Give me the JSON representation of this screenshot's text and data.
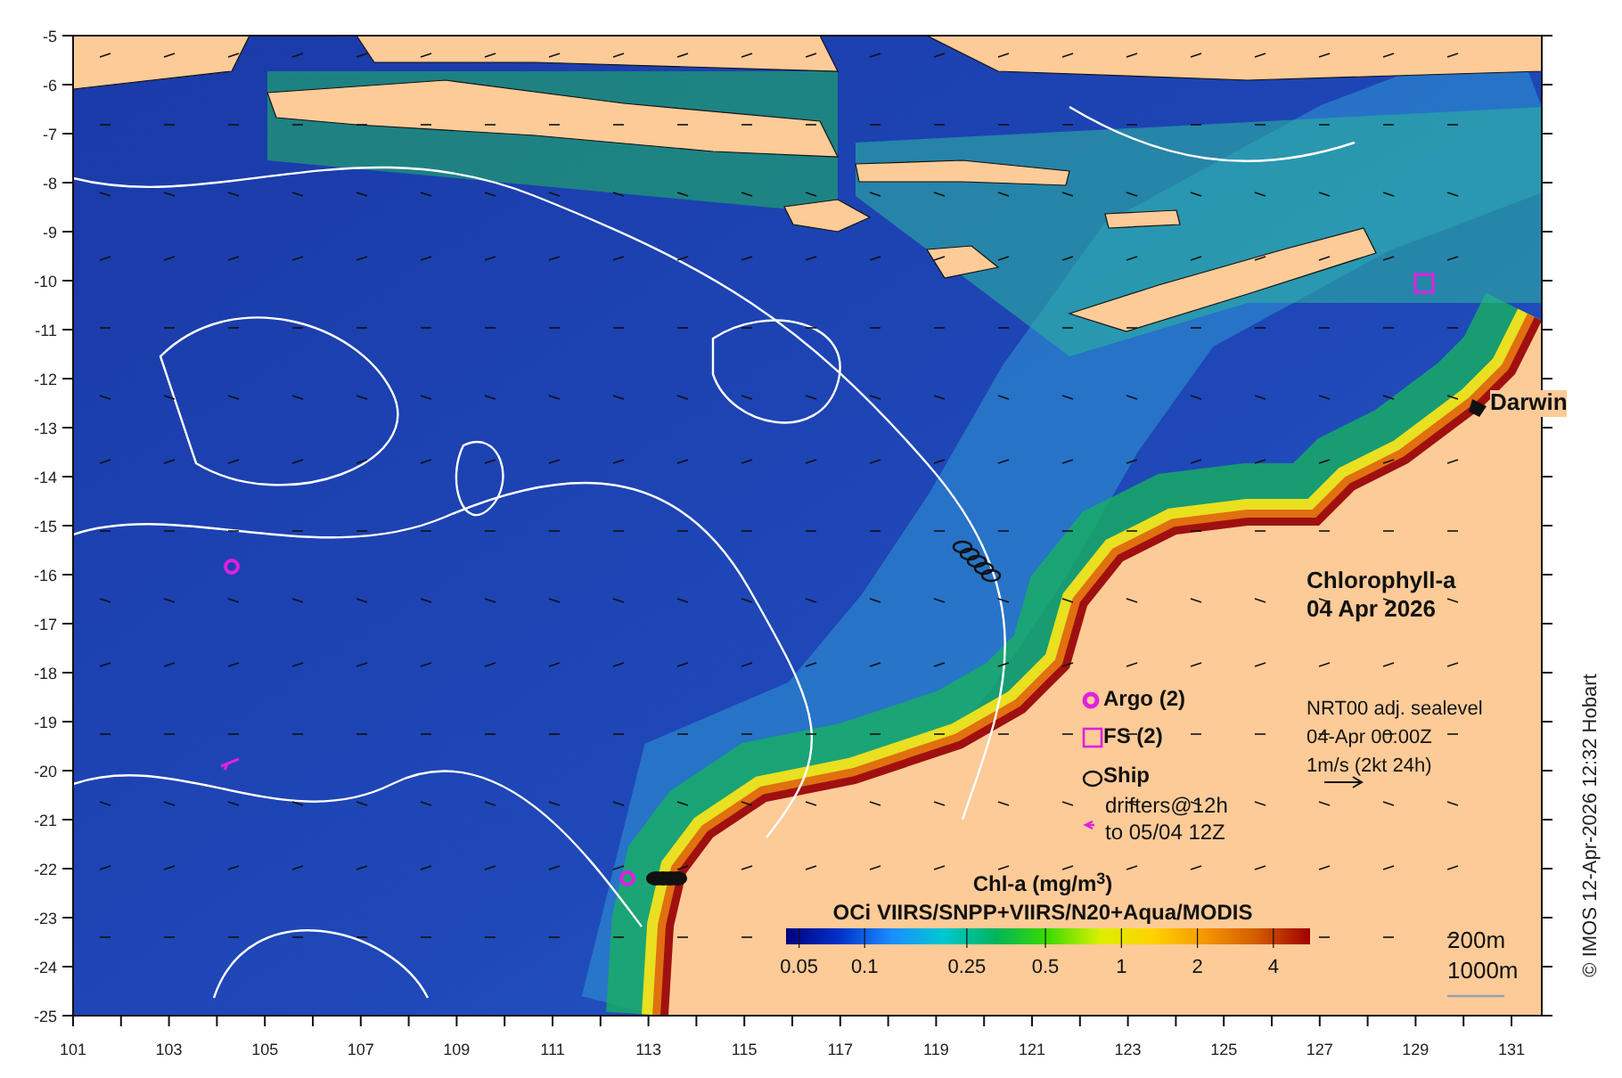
{
  "map": {
    "title": "Chlorophyll-a",
    "date": "04 Apr 2026",
    "place_label": "Darwin",
    "x_ticks": [
      "101",
      "103",
      "105",
      "107",
      "109",
      "111",
      "113",
      "115",
      "117",
      "119",
      "121",
      "123",
      "125",
      "127",
      "129",
      "131"
    ],
    "y_ticks": [
      "-5",
      "-6",
      "-7",
      "-8",
      "-9",
      "-10",
      "-11",
      "-12",
      "-13",
      "-14",
      "-15",
      "-16",
      "-17",
      "-18",
      "-19",
      "-20",
      "-21",
      "-22",
      "-23",
      "-24",
      "-25"
    ]
  },
  "legend": [
    {
      "kind": "argo",
      "label": "Argo (2)"
    },
    {
      "kind": "fs",
      "label": "FS (2)"
    },
    {
      "kind": "ship",
      "label": "Ship"
    },
    {
      "kind": "drifters",
      "label": "drifters@12h",
      "sublabel": "to 05/04 12Z"
    }
  ],
  "sealevel": {
    "lines": [
      "NRT00 adj. sealevel",
      "04-Apr 00:00Z",
      "1m/s (2kt 24h)"
    ]
  },
  "colorbar": {
    "title": "Chl-a (mg/m$^{3}$)",
    "subtitle": "OCi VIIRS/SNPP+VIIRS/N20+Aqua/MODIS",
    "ticks": [
      "0.05",
      "0.1",
      "0.25",
      "0.5",
      "1",
      "2",
      "4"
    ]
  },
  "depth_contours": [
    "200m",
    "1000m"
  ],
  "credit": "© IMOS 12-Apr-2026 12:32 Hobart"
}
